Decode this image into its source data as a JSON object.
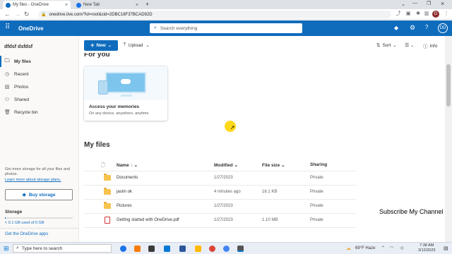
{
  "browser": {
    "tabs": [
      {
        "label": "My files - OneDrive",
        "active": true
      },
      {
        "label": "New Tab",
        "active": false
      }
    ],
    "new_tab_symbol": "+",
    "url": "onedrive.live.com/?id=root&cid=2DBC18F37BCAD92D",
    "profile_initial": "D"
  },
  "app": {
    "name": "OneDrive",
    "search_placeholder": "Search everything",
    "avatar_initials": "DD"
  },
  "sidebar": {
    "user_name": "dfdsf dsfdsf",
    "items": [
      {
        "label": "My files",
        "icon": "folder-icon",
        "selected": true
      },
      {
        "label": "Recent",
        "icon": "clock-icon",
        "selected": false
      },
      {
        "label": "Photos",
        "icon": "image-icon",
        "selected": false
      },
      {
        "label": "Shared",
        "icon": "people-icon",
        "selected": false
      },
      {
        "label": "Recycle bin",
        "icon": "trash-icon",
        "selected": false
      }
    ],
    "promo_text": "Get more storage for all your files and photos.",
    "promo_link": "Learn more about storage plans.",
    "buy_storage": "Buy storage",
    "storage_title": "Storage",
    "storage_usage": "< 0.1 GB used of 5 GB",
    "storage_fraction": 0.01,
    "get_apps": "Get the OneDrive apps"
  },
  "toolbar": {
    "new_label": "New",
    "upload_label": "Upload",
    "sort_label": "Sort",
    "info_label": "Info"
  },
  "for_you": {
    "heading": "For you",
    "card_title": "Access your memories",
    "card_subtitle": "On any device, anywhere, anytime"
  },
  "files": {
    "heading": "My files",
    "columns": {
      "name": "Name",
      "name_sort": "↑",
      "modified": "Modified",
      "size": "File size",
      "sharing": "Sharing"
    },
    "rows": [
      {
        "name": "Documents",
        "modified": "1/27/2023",
        "size": "",
        "sharing": "Private",
        "type": "folder"
      },
      {
        "name": "jasim ok",
        "modified": "4 minutes ago",
        "size": "16.1 KB",
        "sharing": "Private",
        "type": "folder"
      },
      {
        "name": "Pictures",
        "modified": "1/27/2023",
        "size": "",
        "sharing": "Private",
        "type": "folder"
      },
      {
        "name": "Getting started with OneDrive.pdf",
        "modified": "1/27/2023",
        "size": "1.10 MB",
        "sharing": "Private",
        "type": "pdf"
      }
    ]
  },
  "overlay": {
    "subscribe_text": "Subscribe My Channel"
  },
  "taskbar": {
    "search_placeholder": "Type here to search",
    "weather": "69°F Haze",
    "time": "7:38 AM",
    "date": "3/12/2023"
  },
  "colors": {
    "brand": "#0f6cbd",
    "cursor_highlight": "#ffd400",
    "folder": "#f8c34e",
    "pdf": "#d13438"
  }
}
